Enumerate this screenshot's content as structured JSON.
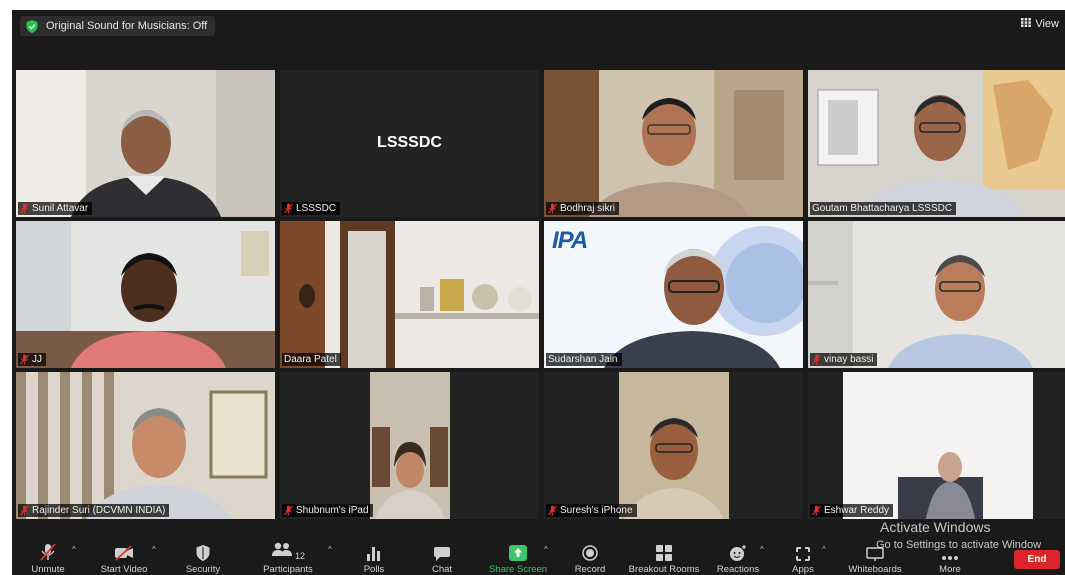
{
  "top_bar": {
    "sound_status": "Original Sound for Musicians: Off",
    "view_label": "View"
  },
  "tiles": [
    {
      "name": "Sunil Attavar",
      "muted": true
    },
    {
      "name": "LSSSDC",
      "muted": true,
      "display_text": "LSSSDC"
    },
    {
      "name": "Bodhraj sikri",
      "muted": true
    },
    {
      "name": "Goutam Bhattacharya LSSSDC",
      "muted": false
    },
    {
      "name": "JJ",
      "muted": true
    },
    {
      "name": "Daara Patel",
      "muted": false
    },
    {
      "name": "Sudarshan Jain",
      "muted": false,
      "active_speaker": true,
      "logo_text": "IPA"
    },
    {
      "name": "vinay bassi",
      "muted": true
    },
    {
      "name": "Rajinder Suri (DCVMN INDIA)",
      "muted": true
    },
    {
      "name": "Shubnum's iPad",
      "muted": true
    },
    {
      "name": "Suresh's iPhone",
      "muted": true
    },
    {
      "name": "Eshwar Reddy",
      "muted": true
    }
  ],
  "toolbar": {
    "unmute": "Unmute",
    "start_video": "Start Video",
    "security": "Security",
    "participants": "Participants",
    "participants_count": "12",
    "polls": "Polls",
    "chat": "Chat",
    "share_screen": "Share Screen",
    "record": "Record",
    "breakout_rooms": "Breakout Rooms",
    "reactions": "Reactions",
    "apps": "Apps",
    "whiteboards": "Whiteboards",
    "more": "More",
    "end": "End"
  },
  "watermark": {
    "line1": "Activate Windows",
    "line2": "Go to Settings to activate Window"
  },
  "colors": {
    "background": "#1a1a1a",
    "active_speaker_border": "#c9d36a",
    "share_green": "#3ec46a",
    "end_red": "#d9262b",
    "mic_off_red": "#e0302f"
  }
}
